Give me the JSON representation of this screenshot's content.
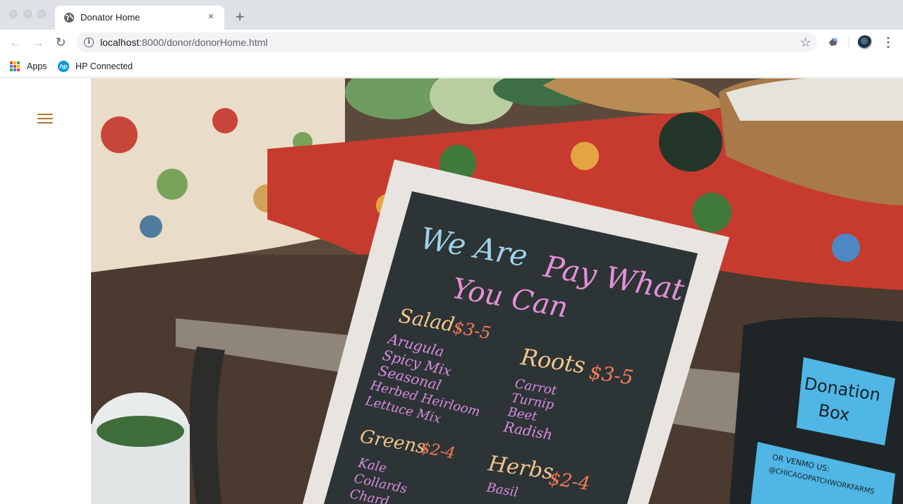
{
  "browser": {
    "tab": {
      "title": "Donator Home",
      "close": "×"
    },
    "new_tab": "+",
    "address": {
      "host": "localhost",
      "path": ":8000/donor/donorHome.html"
    },
    "bookmarks": [
      {
        "label": "Apps"
      },
      {
        "label": "HP Connected",
        "logo_text": "hp"
      }
    ]
  },
  "page": {
    "menu": {
      "icon": "hamburger-menu-icon"
    },
    "hero_image": {
      "chalkboard": {
        "line1": "We Are",
        "line2": "Pay What",
        "line3": "You Can",
        "sections": [
          {
            "title": "Salad",
            "price": "$3-5",
            "items": [
              "Arugula",
              "Spicy Mix",
              "Seasonal",
              "Herbed Heirloom",
              "Lettuce Mix"
            ]
          },
          {
            "title": "Roots",
            "price": "$3-5",
            "items": [
              "Carrot",
              "Turnip",
              "Beet",
              "Radish"
            ]
          },
          {
            "title": "Greens",
            "price": "$2-4",
            "items": [
              "Kale",
              "Collards",
              "Chard"
            ]
          },
          {
            "title": "Herbs",
            "price": "$2-4",
            "items": [
              "Basil"
            ]
          }
        ]
      },
      "donation_box": {
        "label_line1": "Donation",
        "label_line2": "Box",
        "venmo_line1": "OR VENMO US:",
        "venmo_line2": "@CHICAGOPATCHWORKFARMS"
      }
    }
  },
  "colors": {
    "accent": "#b5762c",
    "chalk_blue": "#9fd3ea",
    "chalk_pink": "#e58fd6",
    "chalk_orange": "#f2a35c"
  }
}
